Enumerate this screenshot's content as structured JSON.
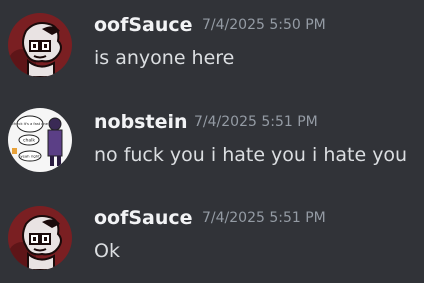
{
  "messages": [
    {
      "author": "oofSauce",
      "timestamp": "7/4/2025 5:50 PM",
      "text": "is anyone here",
      "avatar_icon": "red-cartoon-face-avatar"
    },
    {
      "author": "nobstein",
      "timestamp": "7/4/2025 5:51 PM",
      "text": "no fuck you i hate you i hate you",
      "avatar_icon": "comic-sketch-avatar",
      "avatar_text": [
        "check it's a fast one",
        "chalk",
        "yeah right"
      ]
    },
    {
      "author": "oofSauce",
      "timestamp": "7/4/2025 5:51 PM",
      "text": "Ok",
      "avatar_icon": "red-cartoon-face-avatar"
    }
  ],
  "colors": {
    "background": "#313338",
    "username": "#f2f3f5",
    "timestamp": "#949ba4",
    "text": "#dbdee1",
    "avatar_red": "#7a1f22"
  }
}
